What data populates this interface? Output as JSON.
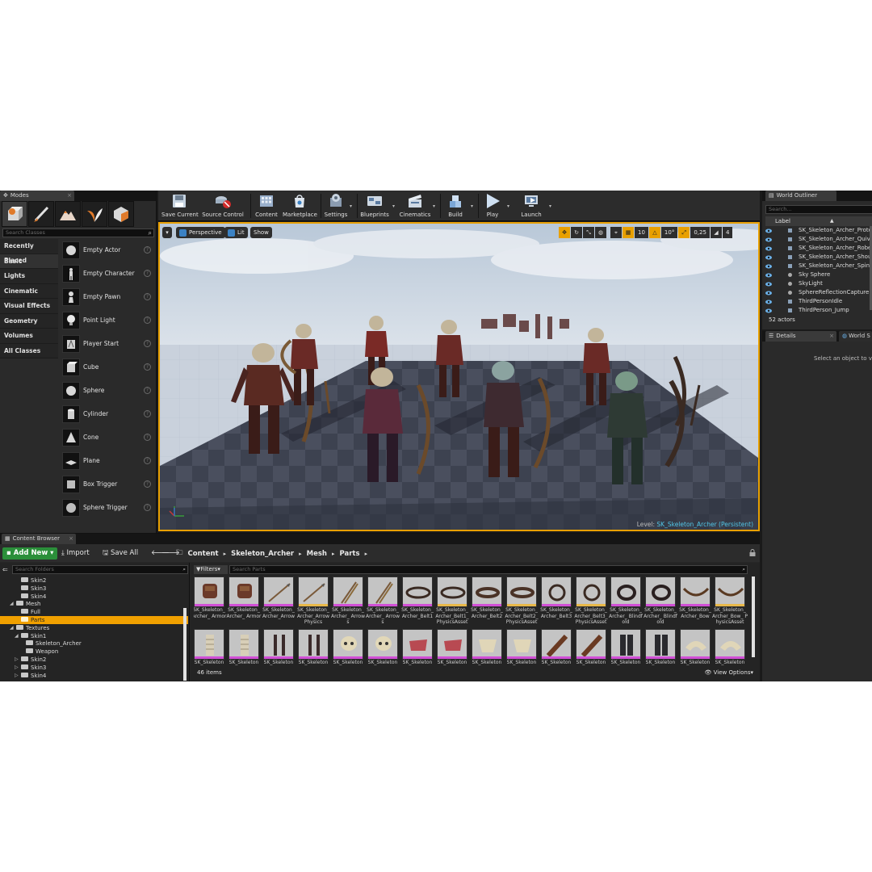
{
  "modes": {
    "tab_title": "Modes",
    "search_placeholder": "Search Classes",
    "mode_icons": [
      "place-mode-icon",
      "paint-mode-icon",
      "landscape-mode-icon",
      "foliage-mode-icon",
      "geometry-mode-icon"
    ],
    "categories": [
      "Recently Placed",
      "Basic",
      "Lights",
      "Cinematic",
      "Visual Effects",
      "Geometry",
      "Volumes",
      "All Classes"
    ],
    "active_category": "Basic",
    "items": [
      {
        "label": "Empty Actor",
        "icon": "sphere-icon"
      },
      {
        "label": "Empty Character",
        "icon": "character-icon"
      },
      {
        "label": "Empty Pawn",
        "icon": "pawn-icon"
      },
      {
        "label": "Point Light",
        "icon": "light-bulb-icon"
      },
      {
        "label": "Player Start",
        "icon": "player-start-icon"
      },
      {
        "label": "Cube",
        "icon": "cube-icon"
      },
      {
        "label": "Sphere",
        "icon": "sphere-icon"
      },
      {
        "label": "Cylinder",
        "icon": "cylinder-icon"
      },
      {
        "label": "Cone",
        "icon": "cone-icon"
      },
      {
        "label": "Plane",
        "icon": "plane-icon"
      },
      {
        "label": "Box Trigger",
        "icon": "box-trigger-icon"
      },
      {
        "label": "Sphere Trigger",
        "icon": "sphere-trigger-icon"
      }
    ]
  },
  "toolbar": {
    "buttons": [
      {
        "label": "Save Current",
        "icon": "save-icon",
        "dropdown": false
      },
      {
        "label": "Source Control",
        "icon": "source-control-icon",
        "dropdown": false
      },
      {
        "label": "Content",
        "icon": "content-icon",
        "dropdown": false
      },
      {
        "label": "Marketplace",
        "icon": "marketplace-icon",
        "dropdown": false
      },
      {
        "label": "Settings",
        "icon": "settings-icon",
        "dropdown": true
      },
      {
        "label": "Blueprints",
        "icon": "blueprints-icon",
        "dropdown": true
      },
      {
        "label": "Cinematics",
        "icon": "cinematics-icon",
        "dropdown": true
      },
      {
        "label": "Build",
        "icon": "build-icon",
        "dropdown": true
      },
      {
        "label": "Play",
        "icon": "play-icon",
        "dropdown": true
      },
      {
        "label": "Launch",
        "icon": "launch-icon",
        "dropdown": true
      }
    ]
  },
  "viewport": {
    "view_mode": "Perspective",
    "lighting": "Lit",
    "show": "Show",
    "grid_snap": "10",
    "rotation_snap": "10°",
    "scale_snap": "0,25",
    "camera_speed": "4",
    "level_label": "Level:",
    "level_name": "SK_Skeleton_Archer (Persistent)",
    "colors": {
      "selection_border": "#e8a000",
      "level_name": "#52c7e8"
    }
  },
  "outliner": {
    "tab_title": "World Outliner",
    "search_placeholder": "Search...",
    "column_label": "Label",
    "rows": [
      {
        "name": "SK_Skeleton_Archer_Protec",
        "icon": "skeletal-mesh-icon"
      },
      {
        "name": "SK_Skeleton_Archer_Quiver",
        "icon": "skeletal-mesh-icon"
      },
      {
        "name": "SK_Skeleton_Archer_Robe",
        "icon": "skeletal-mesh-icon"
      },
      {
        "name": "SK_Skeleton_Archer_Should",
        "icon": "skeletal-mesh-icon"
      },
      {
        "name": "SK_Skeleton_Archer_Spine",
        "icon": "skeletal-mesh-icon"
      },
      {
        "name": "Sky Sphere",
        "icon": "sphere-icon"
      },
      {
        "name": "SkyLight",
        "icon": "skylight-icon"
      },
      {
        "name": "SphereReflectionCapture",
        "icon": "reflection-capture-icon"
      },
      {
        "name": "ThirdPersonIdle",
        "icon": "skeletal-mesh-icon"
      },
      {
        "name": "ThirdPerson_Jump",
        "icon": "skeletal-mesh-icon"
      }
    ],
    "count": "52 actors"
  },
  "details": {
    "tab_title": "Details",
    "tab2_title": "World S",
    "empty_message": "Select an object to vie"
  },
  "content_browser": {
    "tab_title": "Content Browser",
    "add_new": "Add New",
    "import": "Import",
    "save_all": "Save All",
    "breadcrumb": [
      "Content",
      "Skeleton_Archer",
      "Mesh",
      "Parts"
    ],
    "folder_search_placeholder": "Search Folders",
    "filters_label": "Filters",
    "asset_search_placeholder": "Search Parts",
    "tree": [
      {
        "label": "Skin2",
        "depth": 2,
        "expander": "",
        "selected": false
      },
      {
        "label": "Skin3",
        "depth": 2,
        "expander": "",
        "selected": false
      },
      {
        "label": "Skin4",
        "depth": 2,
        "expander": "",
        "selected": false
      },
      {
        "label": "Mesh",
        "depth": 1,
        "expander": "open",
        "selected": false
      },
      {
        "label": "Full",
        "depth": 2,
        "expander": "",
        "selected": false
      },
      {
        "label": "Parts",
        "depth": 2,
        "expander": "",
        "selected": true
      },
      {
        "label": "Textures",
        "depth": 1,
        "expander": "open",
        "selected": false
      },
      {
        "label": "Skin1",
        "depth": 2,
        "expander": "open",
        "selected": false
      },
      {
        "label": "Skeleton_Archer",
        "depth": 3,
        "expander": "",
        "selected": false
      },
      {
        "label": "Weapon",
        "depth": 3,
        "expander": "",
        "selected": false
      },
      {
        "label": "Skin2",
        "depth": 2,
        "expander": "closed",
        "selected": false
      },
      {
        "label": "Skin3",
        "depth": 2,
        "expander": "closed",
        "selected": false
      },
      {
        "label": "Skin4",
        "depth": 2,
        "expander": "closed",
        "selected": false
      }
    ],
    "assets_row1": [
      {
        "name": "SK_Skeleton_ Archer_ Armor",
        "bar": "#d14fd6",
        "thumb": "armor"
      },
      {
        "name": "SK_Skeleton_ Archer_ Armor",
        "bar": "#d14fd6",
        "thumb": "armor"
      },
      {
        "name": "SK_Skeleton_ Archer_Arrow",
        "bar": "#d14fd6",
        "thumb": "arrow"
      },
      {
        "name": "SK_Skeleton_ Archer_Arrow Physics",
        "bar": "#e8b84a",
        "thumb": "arrow"
      },
      {
        "name": "SK_Skeleton_ Archer_ Arrows",
        "bar": "#d14fd6",
        "thumb": "arrows"
      },
      {
        "name": "SK_Skeleton_ Archer_ Arrows",
        "bar": "#d14fd6",
        "thumb": "arrows"
      },
      {
        "name": "SK_Skeleton_ Archer_Belt1",
        "bar": "#d14fd6",
        "thumb": "belt"
      },
      {
        "name": "SK_Skeleton_ Archer_Belt1_ PhysicsAsset",
        "bar": "#e8b84a",
        "thumb": "belt"
      },
      {
        "name": "SK_Skeleton_ Archer_Belt2",
        "bar": "#d14fd6",
        "thumb": "belt2"
      },
      {
        "name": "SK_Skeleton_ Archer_Belt2_ PhysicsAsset",
        "bar": "#e8b84a",
        "thumb": "belt2"
      },
      {
        "name": "SK_Skeleton_ Archer_Belt3",
        "bar": "#d14fd6",
        "thumb": "ring"
      },
      {
        "name": "SK_Skeleton_ Archer_Belt3_ PhysicsAsset",
        "bar": "#e8b84a",
        "thumb": "ring"
      },
      {
        "name": "SK_Skeleton_ Archer_ Blindfold",
        "bar": "#d14fd6",
        "thumb": "blindfold"
      },
      {
        "name": "SK_Skeleton_ Archer_ Blindfold",
        "bar": "#d14fd6",
        "thumb": "blindfold"
      },
      {
        "name": "SK_Skeleton_ Archer_Bow",
        "bar": "#d14fd6",
        "thumb": "bow"
      },
      {
        "name": "SK_Skeleton_ Archer_Bow_ PhysicsAsset",
        "bar": "#e8b84a",
        "thumb": "bow"
      }
    ],
    "assets_row2": [
      {
        "name": "SK_Skeleton",
        "bar": "#d14fd6",
        "thumb": "spine"
      },
      {
        "name": "SK_Skeleton",
        "bar": "#d14fd6",
        "thumb": "spine"
      },
      {
        "name": "SK_Skeleton",
        "bar": "#d14fd6",
        "thumb": "legs"
      },
      {
        "name": "SK_Skeleton",
        "bar": "#d14fd6",
        "thumb": "legs"
      },
      {
        "name": "SK_Skeleton",
        "bar": "#d14fd6",
        "thumb": "skull"
      },
      {
        "name": "SK_Skeleton",
        "bar": "#d14fd6",
        "thumb": "skull"
      },
      {
        "name": "SK_Skeleton",
        "bar": "#d14fd6",
        "thumb": "cloth"
      },
      {
        "name": "SK_Skeleton",
        "bar": "#d14fd6",
        "thumb": "cloth"
      },
      {
        "name": "SK_Skeleton",
        "bar": "#d14fd6",
        "thumb": "pelvis"
      },
      {
        "name": "SK_Skeleton",
        "bar": "#d14fd6",
        "thumb": "pelvis"
      },
      {
        "name": "SK_Skeleton",
        "bar": "#d14fd6",
        "thumb": "quiver"
      },
      {
        "name": "SK_Skeleton",
        "bar": "#d14fd6",
        "thumb": "quiver"
      },
      {
        "name": "SK_Skeleton",
        "bar": "#d14fd6",
        "thumb": "pants"
      },
      {
        "name": "SK_Skeleton",
        "bar": "#d14fd6",
        "thumb": "pants"
      },
      {
        "name": "SK_Skeleton",
        "bar": "#d14fd6",
        "thumb": "shoulder"
      },
      {
        "name": "SK_Skeleton",
        "bar": "#d14fd6",
        "thumb": "shoulder"
      }
    ],
    "items_count": "46 items",
    "view_options": "View Options"
  }
}
